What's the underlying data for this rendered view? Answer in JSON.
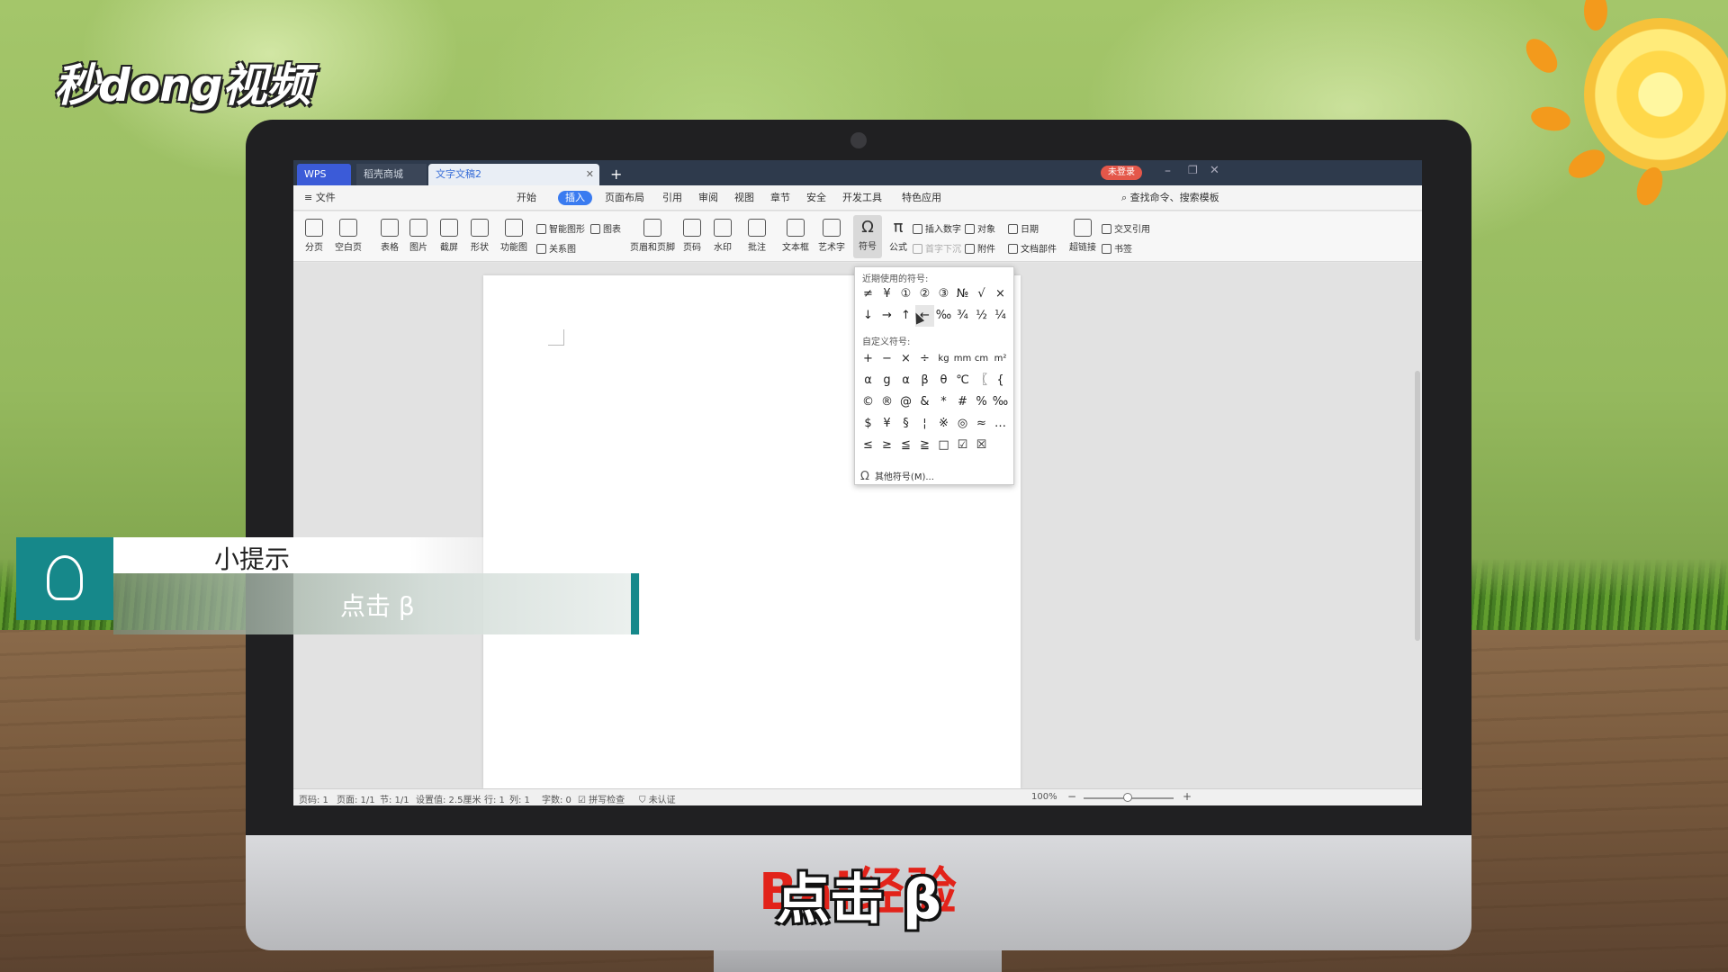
{
  "overlay": {
    "channel_logo": "秒dong视频",
    "tip_title": "小提示",
    "tip_text": "点击 β",
    "bottom_caption": "点击 β",
    "bottom_brand": "Bai经验"
  },
  "tabs": [
    {
      "label": "WPS"
    },
    {
      "label": "稻壳商城"
    },
    {
      "label": "文字文稿2"
    }
  ],
  "window": {
    "login_label": "未登录"
  },
  "menu": {
    "file": "文件",
    "items": [
      "开始",
      "插入",
      "页面布局",
      "引用",
      "审阅",
      "视图",
      "章节",
      "安全",
      "开发工具",
      "特色应用"
    ],
    "selected": "插入",
    "search": "查找命令、搜索模板"
  },
  "ribbon": {
    "buttons": [
      "分页",
      "空白页",
      "表格",
      "图片",
      "截屏",
      "形状",
      "功能图",
      "页眉和页脚",
      "页码",
      "水印",
      "批注",
      "文本框",
      "艺术字",
      "符号",
      "公式",
      "超链接"
    ],
    "small": [
      "智能图形",
      "图表",
      "关系图",
      "插入数字",
      "对象",
      "日期",
      "首字下沉",
      "附件",
      "文档部件",
      "交叉引用",
      "书签"
    ]
  },
  "symbol_dropdown": {
    "recent_label": "近期使用的符号:",
    "recent": [
      "≠",
      "¥",
      "①",
      "②",
      "③",
      "№",
      "√",
      "×",
      "↓",
      "→",
      "↑",
      "←",
      "‰",
      "¾",
      "½",
      "¼"
    ],
    "custom_label": "自定义符号:",
    "custom": [
      "+",
      "−",
      "×",
      "÷",
      "kg",
      "mm",
      "cm",
      "m²",
      "α",
      "g",
      "α",
      "β",
      "θ",
      "℃",
      "〖",
      "{",
      "©",
      "®",
      "@",
      "&",
      "*",
      "#",
      "%",
      "‰",
      "$",
      "¥",
      "§",
      "¦",
      "※",
      "◎",
      "≈",
      "…",
      "≤",
      "≥",
      "≦",
      "≧",
      "□",
      "☑",
      "☒"
    ],
    "more_label": "其他符号(M)..."
  },
  "status": {
    "page_code": "页码: 1",
    "pages": "页面: 1/1",
    "section": "节: 1/1",
    "setting": "设置值: 2.5厘米",
    "row": "行: 1",
    "col": "列: 1",
    "words": "字数: 0",
    "spell": "拼写检查",
    "cert": "未认证",
    "zoom": "100%"
  }
}
